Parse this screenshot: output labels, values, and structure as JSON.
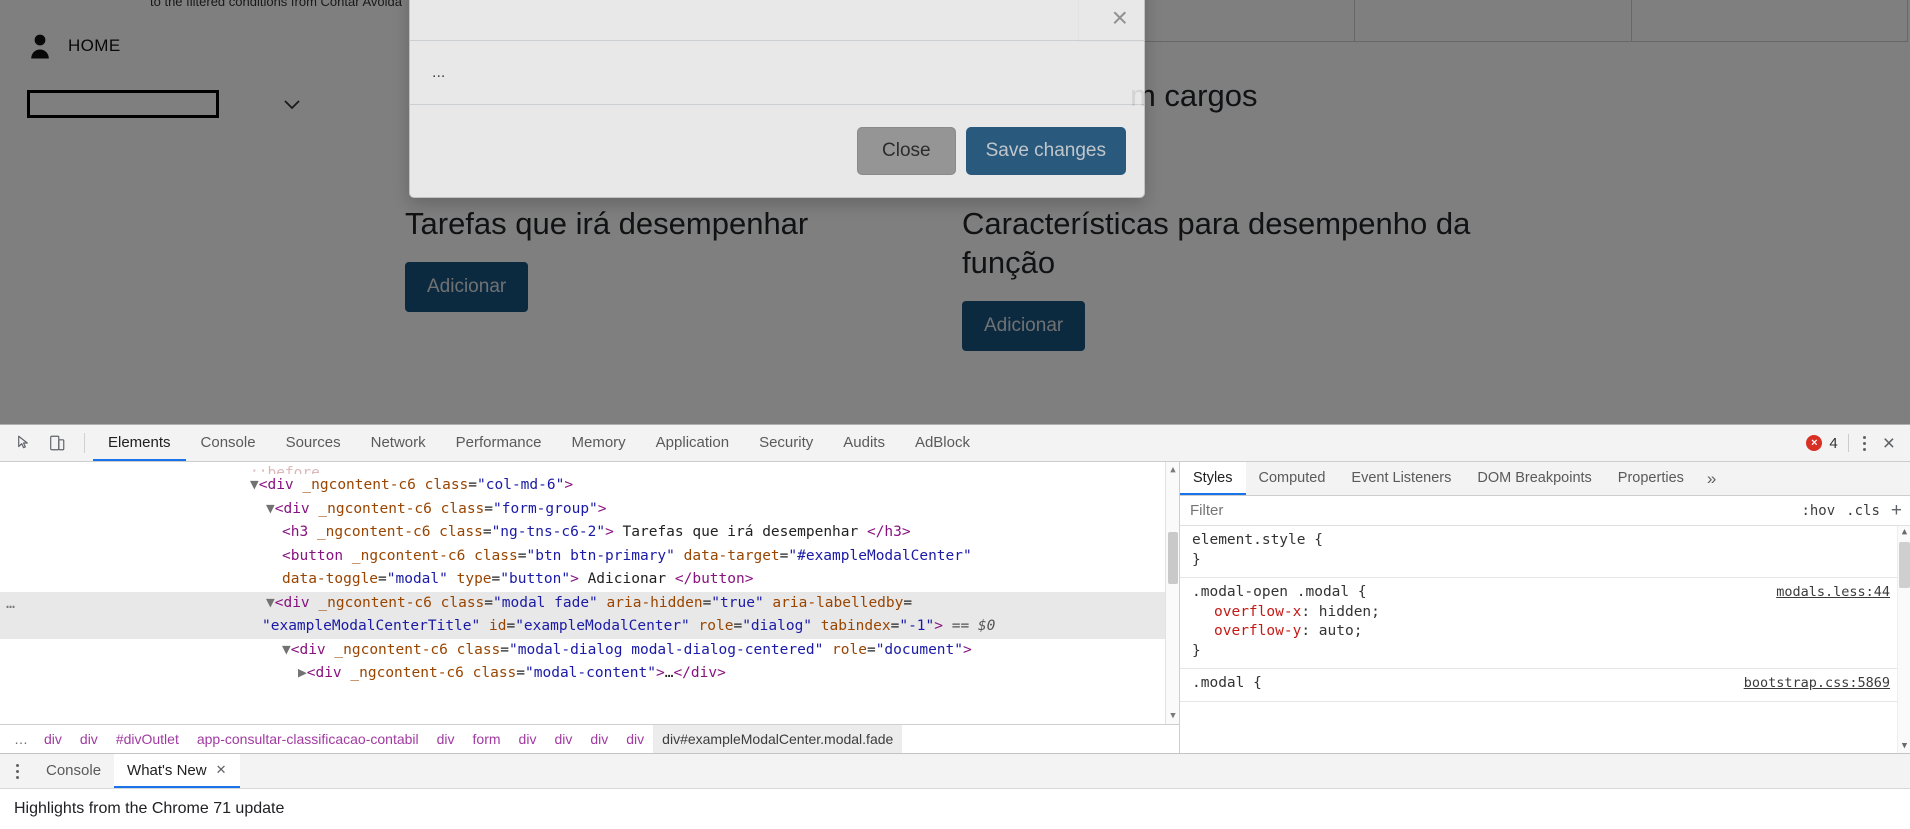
{
  "page": {
    "top_note": "to the filtered conditions from Contar Avoida",
    "nav": {
      "home_label": "HOME",
      "person_icon": "person-icon",
      "chevron_icon": "chevron-down-icon"
    },
    "select_value": "",
    "heading_right_partial": "m cargos",
    "columns": [
      {
        "title": "Tarefas que irá desempenhar",
        "button": "Adicionar"
      },
      {
        "title": "Características para desempenho da função",
        "button": "Adicionar"
      }
    ]
  },
  "modal": {
    "close_icon": "close-icon",
    "title": "",
    "body_text": "...",
    "close_button": "Close",
    "save_button": "Save changes",
    "accent": "#17527e"
  },
  "devtools": {
    "toolbar": {
      "inspect_icon": "inspect-element-icon",
      "device_icon": "device-toolbar-icon",
      "tabs": [
        "Elements",
        "Console",
        "Sources",
        "Network",
        "Performance",
        "Memory",
        "Application",
        "Security",
        "Audits",
        "AdBlock"
      ],
      "active_tab": "Elements",
      "error_count": "4",
      "error_icon": "error-icon",
      "kebab_icon": "more-options-icon",
      "close_icon": "close-devtools-icon"
    },
    "dom": {
      "lines": [
        {
          "indent": 0,
          "html": "<span class=\"txt\" style=\"color:#b36262\">::before</span>",
          "selected": false,
          "clipped": true
        },
        {
          "indent": 0,
          "html": "<span class=\"arrow\">▼</span><span class=\"punc\">&lt;</span><span class=\"tag\">div</span> <span class=\"attr\">_ngcontent-c6</span> <span class=\"attr\">class</span>=<span class=\"val\">\"col-md-6\"</span><span class=\"punc\">&gt;</span>",
          "selected": false
        },
        {
          "indent": 1,
          "html": "<span class=\"arrow\">▼</span><span class=\"punc\">&lt;</span><span class=\"tag\">div</span> <span class=\"attr\">_ngcontent-c6</span> <span class=\"attr\">class</span>=<span class=\"val\">\"form-group\"</span><span class=\"punc\">&gt;</span>",
          "selected": false
        },
        {
          "indent": 2,
          "html": "<span class=\"punc\">&lt;</span><span class=\"tag\">h3</span> <span class=\"attr\">_ngcontent-c6</span> <span class=\"attr\">class</span>=<span class=\"val\">\"ng-tns-c6-2\"</span><span class=\"punc\">&gt;</span> <span class=\"txt\">Tarefas que irá desempenhar</span> <span class=\"punc\">&lt;/h3&gt;</span>",
          "selected": false
        },
        {
          "indent": 2,
          "html": "<span class=\"punc\">&lt;</span><span class=\"tag\">button</span> <span class=\"attr\">_ngcontent-c6</span> <span class=\"attr\">class</span>=<span class=\"val\">\"btn btn-primary\"</span> <span class=\"attr\">data-target</span>=<span class=\"val\">\"#exampleModalCenter\"</span>",
          "selected": false
        },
        {
          "indent": 2,
          "html": "<span class=\"attr\">data-toggle</span>=<span class=\"val\">\"modal\"</span> <span class=\"attr\">type</span>=<span class=\"val\">\"button\"</span><span class=\"punc\">&gt;</span> <span class=\"txt\">Adicionar</span> <span class=\"punc\">&lt;/button&gt;</span>",
          "selected": false
        },
        {
          "indent": 1,
          "html": "<span class=\"arrow\">▼</span><span class=\"punc\">&lt;</span><span class=\"tag\">div</span> <span class=\"attr\">_ngcontent-c6</span> <span class=\"attr\">class</span>=<span class=\"val\">\"modal fade\"</span> <span class=\"attr\">aria-hidden</span>=<span class=\"val\">\"true\"</span> <span class=\"attr\">aria-labelledby</span>=",
          "selected": true,
          "gutter": "…"
        },
        {
          "indent": 0,
          "html": "<span class=\"val\">\"exampleModalCenterTitle\"</span> <span class=\"attr\">id</span>=<span class=\"val\">\"exampleModalCenter\"</span> <span class=\"attr\">role</span>=<span class=\"val\">\"dialog\"</span> <span class=\"attr\">tabindex</span>=<span class=\"val\">\"-1\"</span><span class=\"punc\">&gt;</span> <span class=\"dollr\">== $0</span>",
          "selected": true,
          "noindentmark": true
        },
        {
          "indent": 2,
          "html": "<span class=\"arrow\">▼</span><span class=\"punc\">&lt;</span><span class=\"tag\">div</span> <span class=\"attr\">_ngcontent-c6</span> <span class=\"attr\">class</span>=<span class=\"val\">\"modal-dialog modal-dialog-centered\"</span> <span class=\"attr\">role</span>=<span class=\"val\">\"document\"</span><span class=\"punc\">&gt;</span>",
          "selected": false
        },
        {
          "indent": 3,
          "html": "<span class=\"arrow\">▶</span><span class=\"punc\">&lt;</span><span class=\"tag\">div</span> <span class=\"attr\">_ngcontent-c6</span> <span class=\"attr\">class</span>=<span class=\"val\">\"modal-content\"</span><span class=\"punc\">&gt;</span><span class=\"txt\">…</span><span class=\"punc\">&lt;/div&gt;</span>",
          "selected": false
        }
      ],
      "breadcrumbs": [
        {
          "label": "…",
          "kind": "dots"
        },
        {
          "label": "div",
          "kind": "tag"
        },
        {
          "label": "div",
          "kind": "tag"
        },
        {
          "label": "#divOutlet",
          "kind": "tag"
        },
        {
          "label": "app-consultar-classificacao-contabil",
          "kind": "tag"
        },
        {
          "label": "div",
          "kind": "tag"
        },
        {
          "label": "form",
          "kind": "tag"
        },
        {
          "label": "div",
          "kind": "tag"
        },
        {
          "label": "div",
          "kind": "tag"
        },
        {
          "label": "div",
          "kind": "tag"
        },
        {
          "label": "div",
          "kind": "tag"
        },
        {
          "label": "div#exampleModalCenter.modal.fade",
          "kind": "active"
        }
      ]
    },
    "styles": {
      "tabs": [
        "Styles",
        "Computed",
        "Event Listeners",
        "DOM Breakpoints",
        "Properties"
      ],
      "active_tab": "Styles",
      "more_icon": "chevron-right-more-icon",
      "filter_placeholder": "Filter",
      "filter_value": "",
      "hov_label": ":hov",
      "cls_label": ".cls",
      "plus_label": "+",
      "rules": [
        {
          "selector": "element.style {",
          "close": "}",
          "source": "",
          "decls": []
        },
        {
          "selector": ".modal-open .modal {",
          "close": "}",
          "source": "modals.less:44",
          "decls": [
            {
              "prop": "overflow-x",
              "value": "hidden;"
            },
            {
              "prop": "overflow-y",
              "value": "auto;"
            }
          ]
        },
        {
          "selector": ".modal {",
          "close": "",
          "source": "bootstrap.css:5869",
          "decls": []
        }
      ]
    },
    "drawer": {
      "kebab_icon": "drawer-more-icon",
      "tabs": [
        {
          "label": "Console",
          "closable": false,
          "active": false
        },
        {
          "label": "What's New",
          "closable": true,
          "active": true
        }
      ],
      "close_icon": "close-tab-icon",
      "body_text": "Highlights from the Chrome 71 update"
    }
  }
}
